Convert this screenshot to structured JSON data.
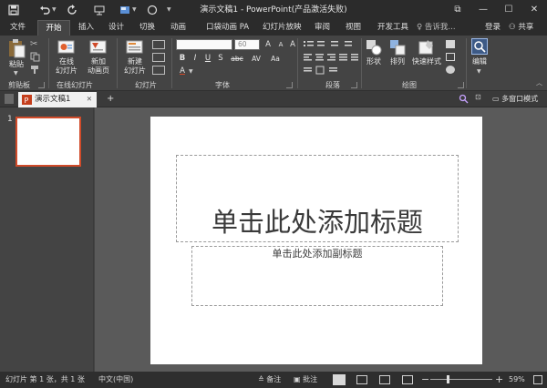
{
  "window": {
    "title": "演示文稿1 - PowerPoint(产品激活失败)",
    "restore_glyph": "⧉",
    "minimize_glyph": "—",
    "maximize_glyph": "☐",
    "close_glyph": "✕"
  },
  "qat": {
    "save_icon": "save-icon",
    "undo_icon": "undo-icon",
    "redo_icon": "redo-icon",
    "start_from_beginning_icon": "slideshow-icon",
    "circle_shape_icon": "circle-icon"
  },
  "tabs": [
    "文件",
    "开始",
    "插入",
    "设计",
    "切换",
    "动画",
    "口袋动画 PA",
    "幻灯片放映",
    "审阅",
    "视图",
    "开发工具"
  ],
  "tell_me": "♀ 告诉我...",
  "login": "登录",
  "share": "共享",
  "ribbon": {
    "clipboard": {
      "paste": "粘贴",
      "label": "剪贴板"
    },
    "online_slides": {
      "online": "在线",
      "online2": "幻灯片",
      "new_anim": "新加",
      "new_anim2": "动画页",
      "label": "在线幻灯片"
    },
    "slides": {
      "new_slide": "新建",
      "new_slide2": "幻灯片",
      "label": "幻灯片"
    },
    "font": {
      "font_name": "",
      "font_size": "60",
      "label": "字体",
      "bold": "B",
      "italic": "I",
      "underline": "U",
      "strike": "S",
      "abc": "abc",
      "av": "AV",
      "aa": "Aa",
      "a_big": "A",
      "a_small": "A",
      "clear": "A"
    },
    "paragraph": {
      "label": "段落"
    },
    "drawing": {
      "shape": "形状",
      "arrange": "排列",
      "quick_style": "快速样式",
      "label": "绘图"
    },
    "editing": {
      "edit": "编辑"
    }
  },
  "document_tab": {
    "name": "演示文稿1",
    "close": "✕",
    "add": "+"
  },
  "multi_window": "多窗口模式",
  "thumbnail_number": "1",
  "slide": {
    "title_placeholder": "单击此处添加标题",
    "subtitle_placeholder": "单击此处添加副标题"
  },
  "status": {
    "slide_info": "幻灯片 第 1 张，共 1 张",
    "language": "中文(中国)",
    "notes": "备注",
    "comments": "批注",
    "zoom": "59%",
    "zoom_fraction": 0.59
  },
  "colors": {
    "accent": "#d04b2a",
    "dark_bg": "#444444",
    "titlebar": "#2b2b2b"
  }
}
